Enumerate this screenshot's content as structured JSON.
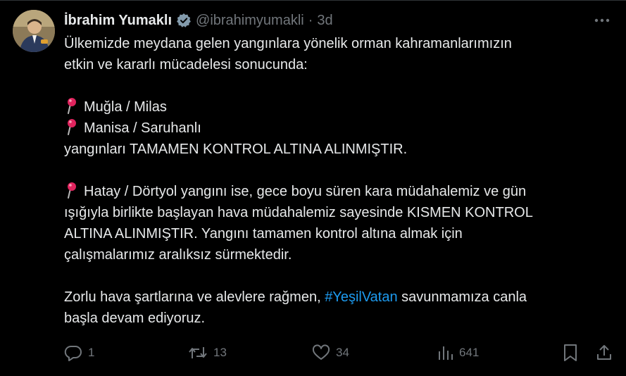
{
  "author": {
    "display_name": "İbrahim Yumaklı",
    "handle": "@ibrahimyumakli",
    "separator": "·",
    "time": "3d",
    "avatar_icon": "avatar-photo",
    "verified_icon": "verified-badge-icon"
  },
  "tweet": {
    "lines": [
      "Ülkemizde meydana gelen yangınlara yönelik orman kahramanlarımızın",
      "etkin ve kararlı mücadelesi sonucunda:"
    ],
    "pin_line_1": "Muğla / Milas",
    "pin_line_2": "Manisa / Saruhanlı",
    "line_controlled": "yangınları TAMAMEN KONTROL ALTINA ALINMIŞTIR.",
    "pin_line_3": "Hatay / Dörtyol yangını ise, gece boyu süren kara müdahalemiz ve gün",
    "para2": [
      "ışığıyla birlikte başlayan hava müdahalemiz sayesinde KISMEN KONTROL",
      "ALTINA ALINMIŞTIR. Yangını tamamen kontrol altına almak için",
      "çalışmalarımız aralıksız sürmektedir."
    ],
    "para3_start": "Zorlu hava şartlarına ve alevlere rağmen, ",
    "hashtag": "#YeşilVatan",
    "para3_end": " savunmamıza canla",
    "para3_last": "başla devam ediyoruz."
  },
  "actions": {
    "replies": "1",
    "retweets": "13",
    "likes": "34",
    "views": "641"
  },
  "colors": {
    "background": "#000000",
    "text": "#e7e9ea",
    "muted": "#71767b",
    "link": "#1d9bf0",
    "pin": "#e0245e"
  }
}
